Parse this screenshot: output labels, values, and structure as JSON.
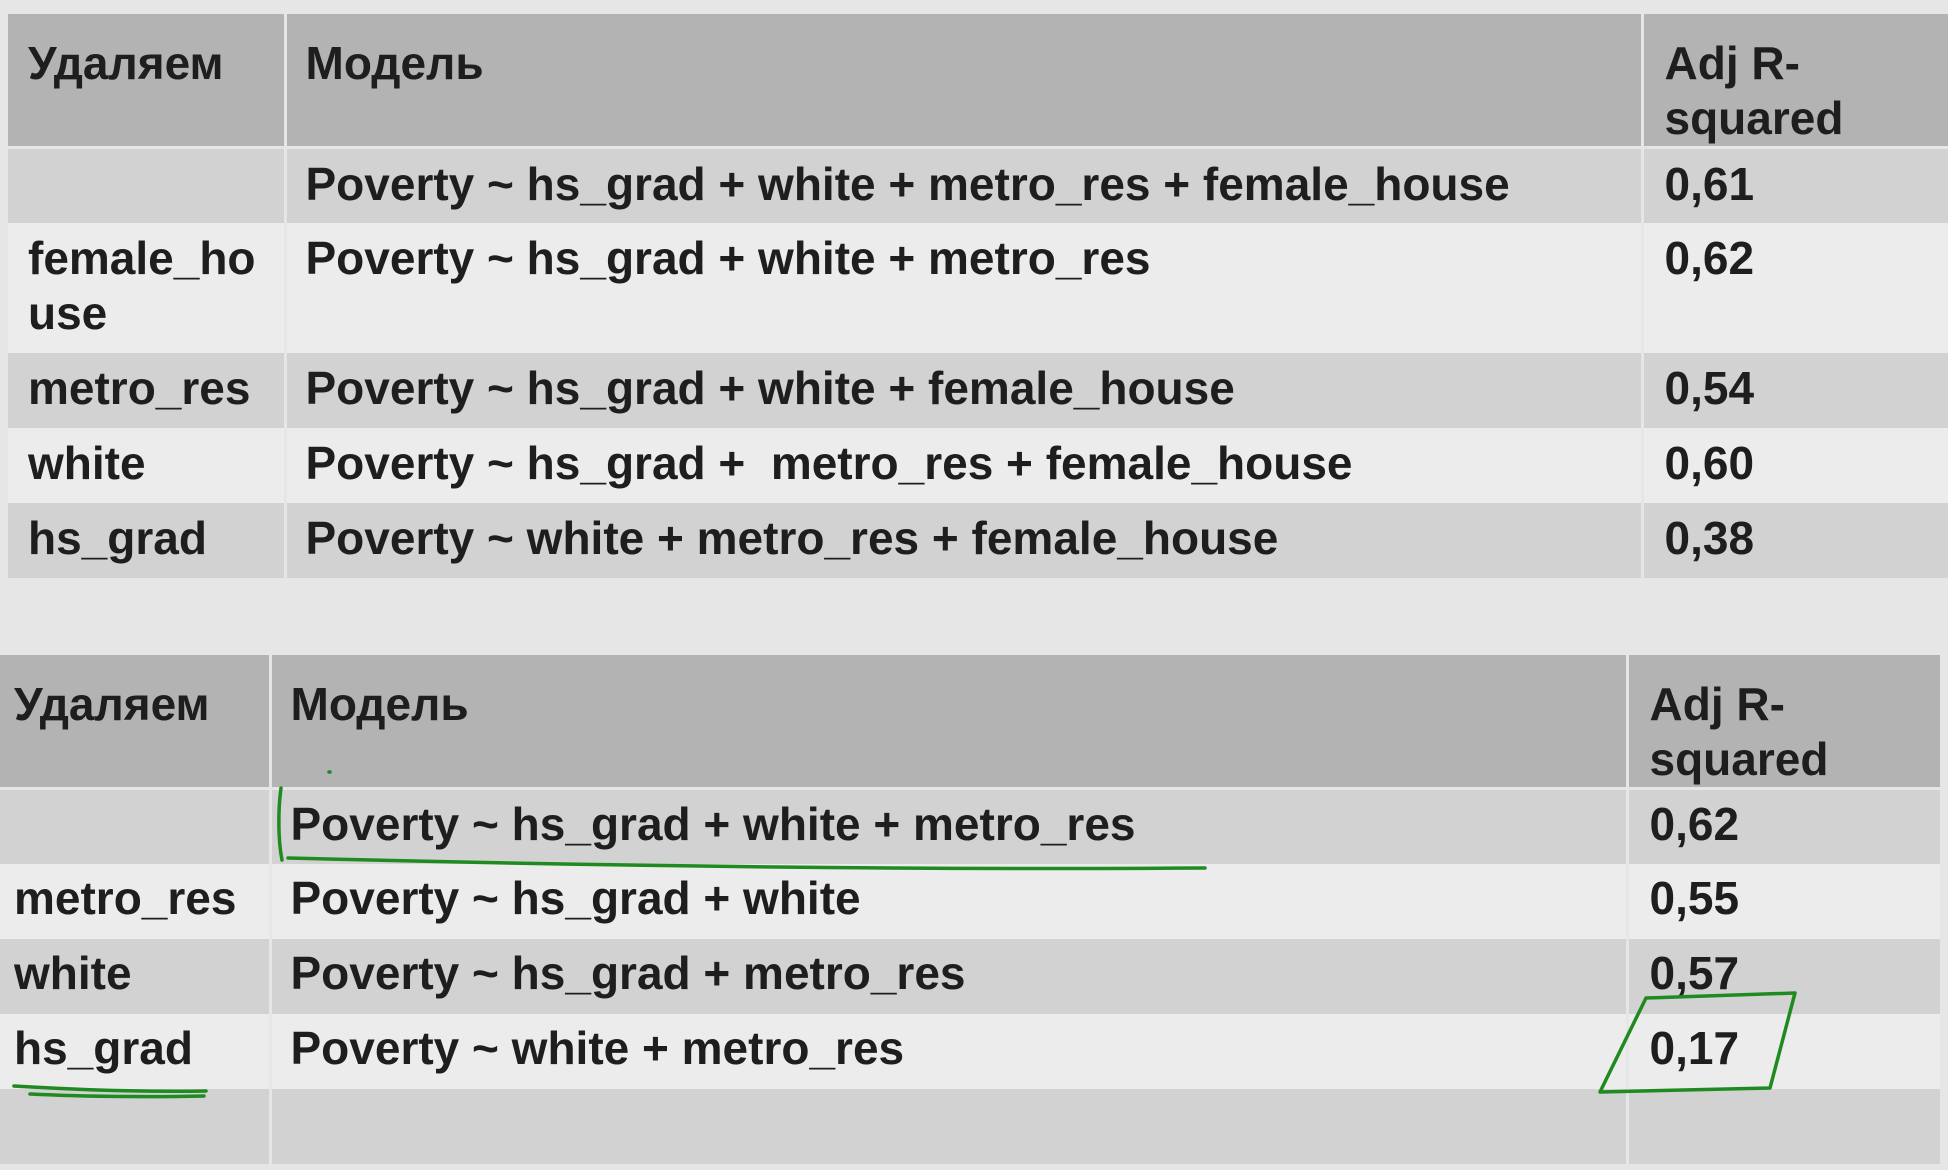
{
  "table_top": {
    "headers": {
      "removed": "Удаляем",
      "model": "Модель",
      "adj_r2": "Adj R-squared"
    },
    "rows": [
      {
        "removed": "",
        "model": "Poverty ~ hs_grad + white + metro_res + female_house",
        "adj_r2": "0,61"
      },
      {
        "removed": "female_house",
        "model": "Poverty ~ hs_grad + white + metro_res",
        "adj_r2": "0,62"
      },
      {
        "removed": "metro_res",
        "model": "Poverty ~ hs_grad + white + female_house",
        "adj_r2": "0,54"
      },
      {
        "removed": "white",
        "model": "Poverty ~ hs_grad +  metro_res + female_house",
        "adj_r2": "0,60"
      },
      {
        "removed": "hs_grad",
        "model": "Poverty ~ white + metro_res + female_house",
        "adj_r2": "0,38"
      }
    ]
  },
  "table_bottom": {
    "headers": {
      "removed": "Удаляем",
      "model": "Модель",
      "adj_r2": "Adj R-squared"
    },
    "rows": [
      {
        "removed": "",
        "model": "Poverty ~ hs_grad + white + metro_res",
        "adj_r2": "0,62"
      },
      {
        "removed": "metro_res",
        "model": "Poverty ~ hs_grad + white",
        "adj_r2": "0,55"
      },
      {
        "removed": "white",
        "model": "Poverty ~ hs_grad + metro_res",
        "adj_r2": "0,57"
      },
      {
        "removed": "hs_grad",
        "model": "Poverty ~ white + metro_res",
        "adj_r2": "0,17"
      },
      {
        "removed": "",
        "model": "",
        "adj_r2": ""
      }
    ]
  },
  "annotations": {
    "ink_color": "#1f8a1f"
  }
}
